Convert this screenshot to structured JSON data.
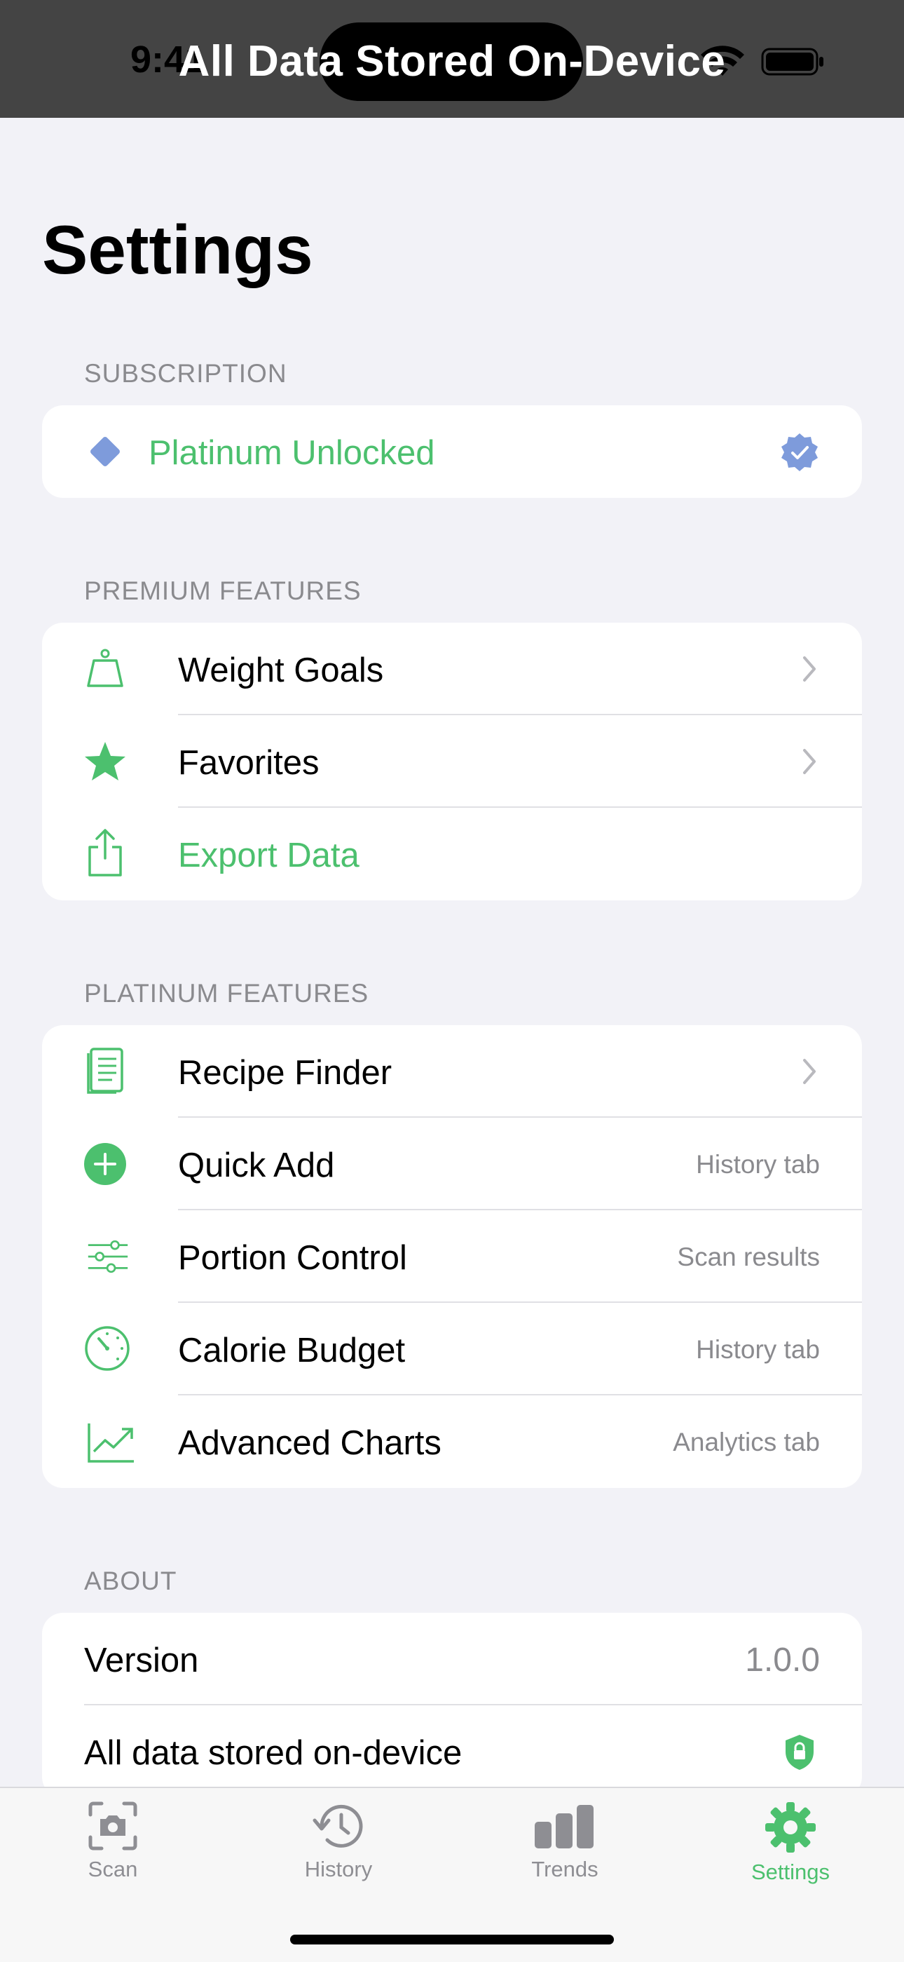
{
  "status_bar": {
    "time": "9:41",
    "banner": "All Data Stored On-Device"
  },
  "title": "Settings",
  "subscription": {
    "header": "SUBSCRIPTION",
    "label": "Platinum Unlocked"
  },
  "premium": {
    "header": "PREMIUM FEATURES",
    "items": [
      {
        "label": "Weight Goals",
        "icon": "scale-icon"
      },
      {
        "label": "Favorites",
        "icon": "star-icon"
      },
      {
        "label": "Export Data",
        "icon": "share-icon"
      }
    ]
  },
  "platinum": {
    "header": "PLATINUM FEATURES",
    "items": [
      {
        "label": "Recipe Finder",
        "detail": "",
        "icon": "book-icon"
      },
      {
        "label": "Quick Add",
        "detail": "History tab",
        "icon": "plus-circle-icon"
      },
      {
        "label": "Portion Control",
        "detail": "Scan results",
        "icon": "sliders-icon"
      },
      {
        "label": "Calorie Budget",
        "detail": "History tab",
        "icon": "gauge-icon"
      },
      {
        "label": "Advanced Charts",
        "detail": "Analytics tab",
        "icon": "chart-icon"
      }
    ]
  },
  "about": {
    "header": "ABOUT",
    "version_label": "Version",
    "version_value": "1.0.0",
    "storage_label": "All data stored on-device"
  },
  "tabs": [
    {
      "label": "Scan",
      "icon": "camera-icon"
    },
    {
      "label": "History",
      "icon": "history-icon"
    },
    {
      "label": "Trends",
      "icon": "bars-icon"
    },
    {
      "label": "Settings",
      "icon": "gear-icon",
      "active": true
    }
  ],
  "colors": {
    "accent": "#4CC06E",
    "background": "#F2F2F7",
    "badge": "#7E9BDB"
  }
}
